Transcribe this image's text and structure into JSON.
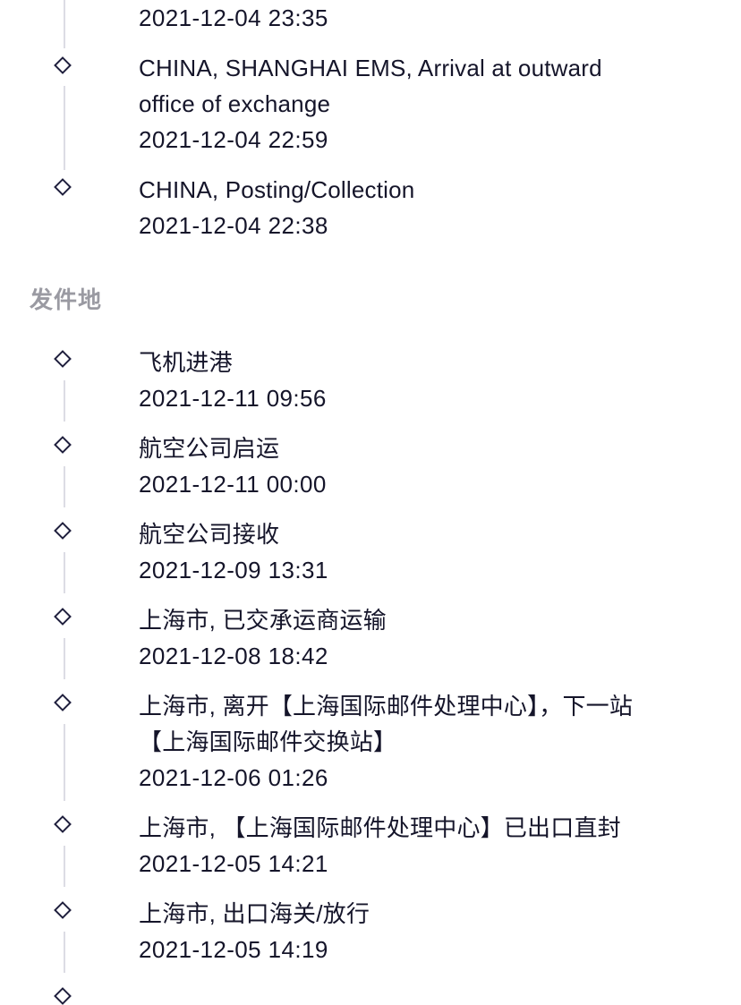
{
  "colors": {
    "text": "#15152a",
    "section_label": "#9a9aa2",
    "diamond_stroke": "#1f1f3d",
    "connector": "#dcdce4",
    "background": "#ffffff"
  },
  "destination_events": {
    "top_partial_time": "2021-12-04 23:35",
    "items": [
      {
        "title_line1": "CHINA, SHANGHAI EMS, Arrival at outward",
        "title_line2": "office of exchange",
        "time": "2021-12-04 22:59",
        "icon": "diamond-icon"
      },
      {
        "title_line1": "CHINA, Posting/Collection",
        "time": "2021-12-04 22:38",
        "icon": "diamond-icon"
      }
    ]
  },
  "origin_section": {
    "label": "发件地",
    "items": [
      {
        "title_line1": "飞机进港",
        "time": "2021-12-11 09:56",
        "icon": "diamond-icon"
      },
      {
        "title_line1": "航空公司启运",
        "time": "2021-12-11 00:00",
        "icon": "diamond-icon"
      },
      {
        "title_line1": "航空公司接收",
        "time": "2021-12-09 13:31",
        "icon": "diamond-icon"
      },
      {
        "title_line1": "上海市, 已交承运商运输",
        "time": "2021-12-08 18:42",
        "icon": "diamond-icon"
      },
      {
        "title_line1": "上海市, 离开【上海国际邮件处理中心】，下一站",
        "title_line2": "【上海国际邮件交换站】",
        "time": "2021-12-06 01:26",
        "icon": "diamond-icon"
      },
      {
        "title_line1": "上海市, 【上海国际邮件处理中心】已出口直封",
        "time": "2021-12-05 14:21",
        "icon": "diamond-icon"
      },
      {
        "title_line1": "上海市, 出口海关/放行",
        "time": "2021-12-05 14:19",
        "icon": "diamond-icon"
      }
    ]
  }
}
